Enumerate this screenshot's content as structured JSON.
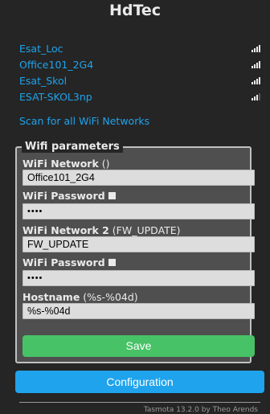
{
  "header": {
    "title": "HdTec"
  },
  "networks": [
    {
      "ssid": "Esat_Loc",
      "signal_bars": 4
    },
    {
      "ssid": "Office101_2G4",
      "signal_bars": 4
    },
    {
      "ssid": "Esat_Skol",
      "signal_bars": 4
    },
    {
      "ssid": "ESAT-SKOL3np",
      "signal_bars": 3
    }
  ],
  "scan_link": "Scan for all WiFi Networks",
  "form": {
    "legend": "Wifi parameters",
    "wifi_network_label": "WiFi Network",
    "wifi_network_suffix": " ()",
    "wifi_network_value": "Office101_2G4",
    "wifi_password_label": "WiFi Password",
    "wifi_password_value": "••••",
    "wifi_network2_label": "WiFi Network 2",
    "wifi_network2_suffix": " (FW_UPDATE)",
    "wifi_network2_value": "FW_UPDATE",
    "wifi_password2_label": "WiFi Password",
    "wifi_password2_value": "••••",
    "hostname_label": "Hostname",
    "hostname_suffix": " (%s-%04d)",
    "hostname_value": "%s-%04d",
    "save_label": "Save"
  },
  "config_button": "Configuration",
  "footer": "Tasmota 13.2.0 by Theo Arends",
  "colors": {
    "link": "#1fa3ec",
    "save": "#47c266",
    "config": "#1fa3ec",
    "background": "#252525"
  }
}
